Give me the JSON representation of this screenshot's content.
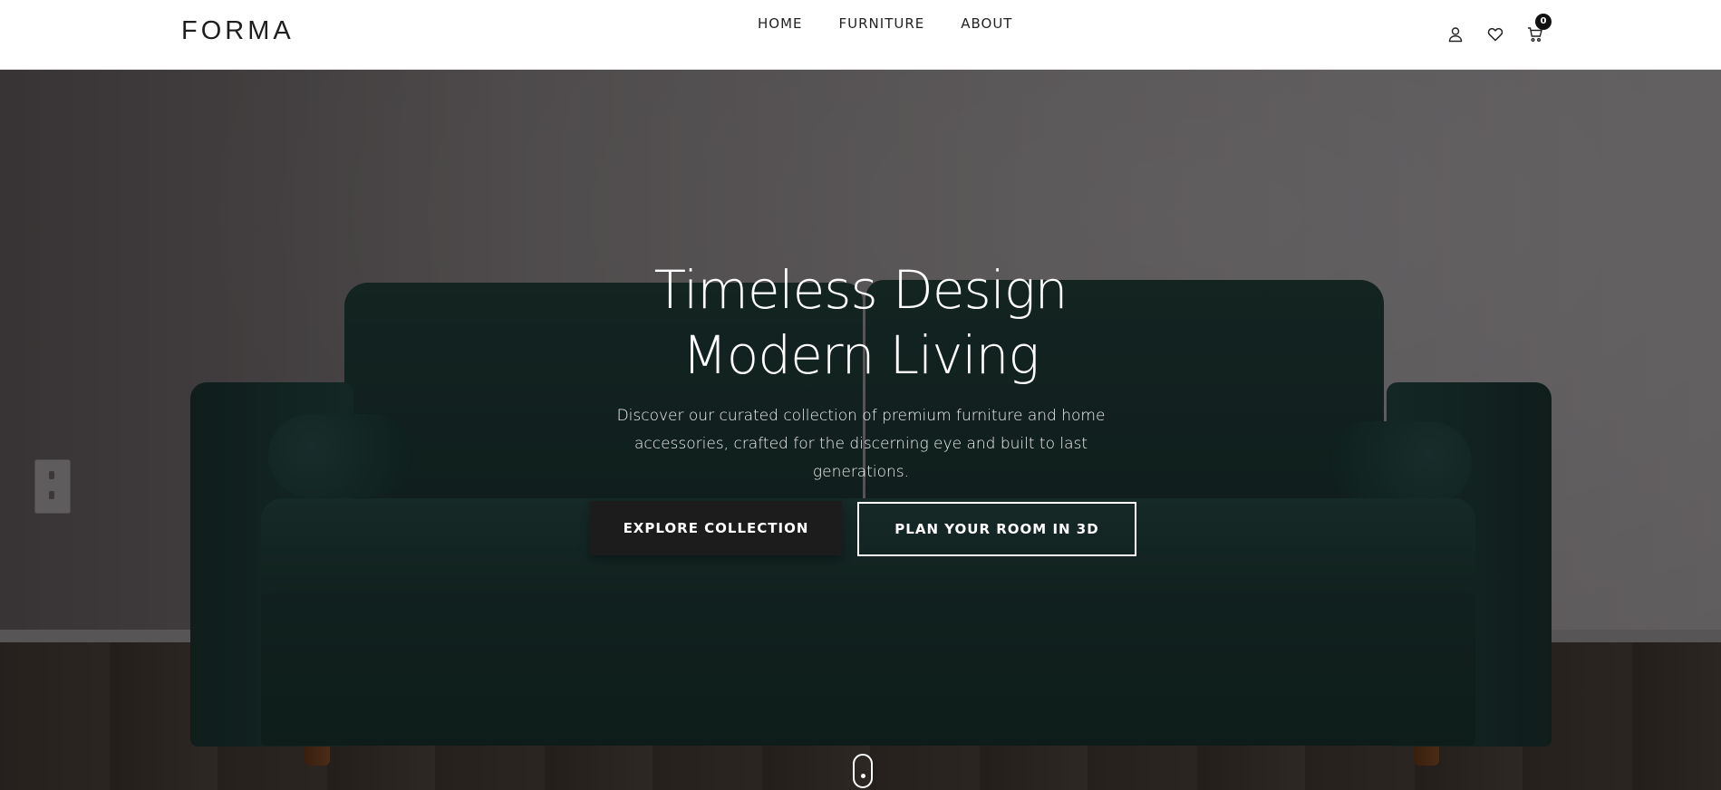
{
  "header": {
    "logo": "FORMA",
    "nav": [
      {
        "label": "HOME"
      },
      {
        "label": "FURNITURE"
      },
      {
        "label": "ABOUT"
      }
    ],
    "icons": [
      "user-icon",
      "heart-icon",
      "cart-icon"
    ],
    "cart_count": "0"
  },
  "hero": {
    "title_line1": "Timeless Design",
    "title_line2": "Modern Living",
    "subtitle": "Discover our curated collection of premium furniture and home accessories, crafted for the discerning eye and built to last generations.",
    "primary_button": "EXPLORE COLLECTION",
    "secondary_button": "PLAN YOUR ROOM IN 3D"
  },
  "colors": {
    "header_bg": "#ffffff",
    "text_dark": "#1e1e1e",
    "sofa_green": "#1f3a36",
    "button_dark": "#1c1c1c"
  }
}
